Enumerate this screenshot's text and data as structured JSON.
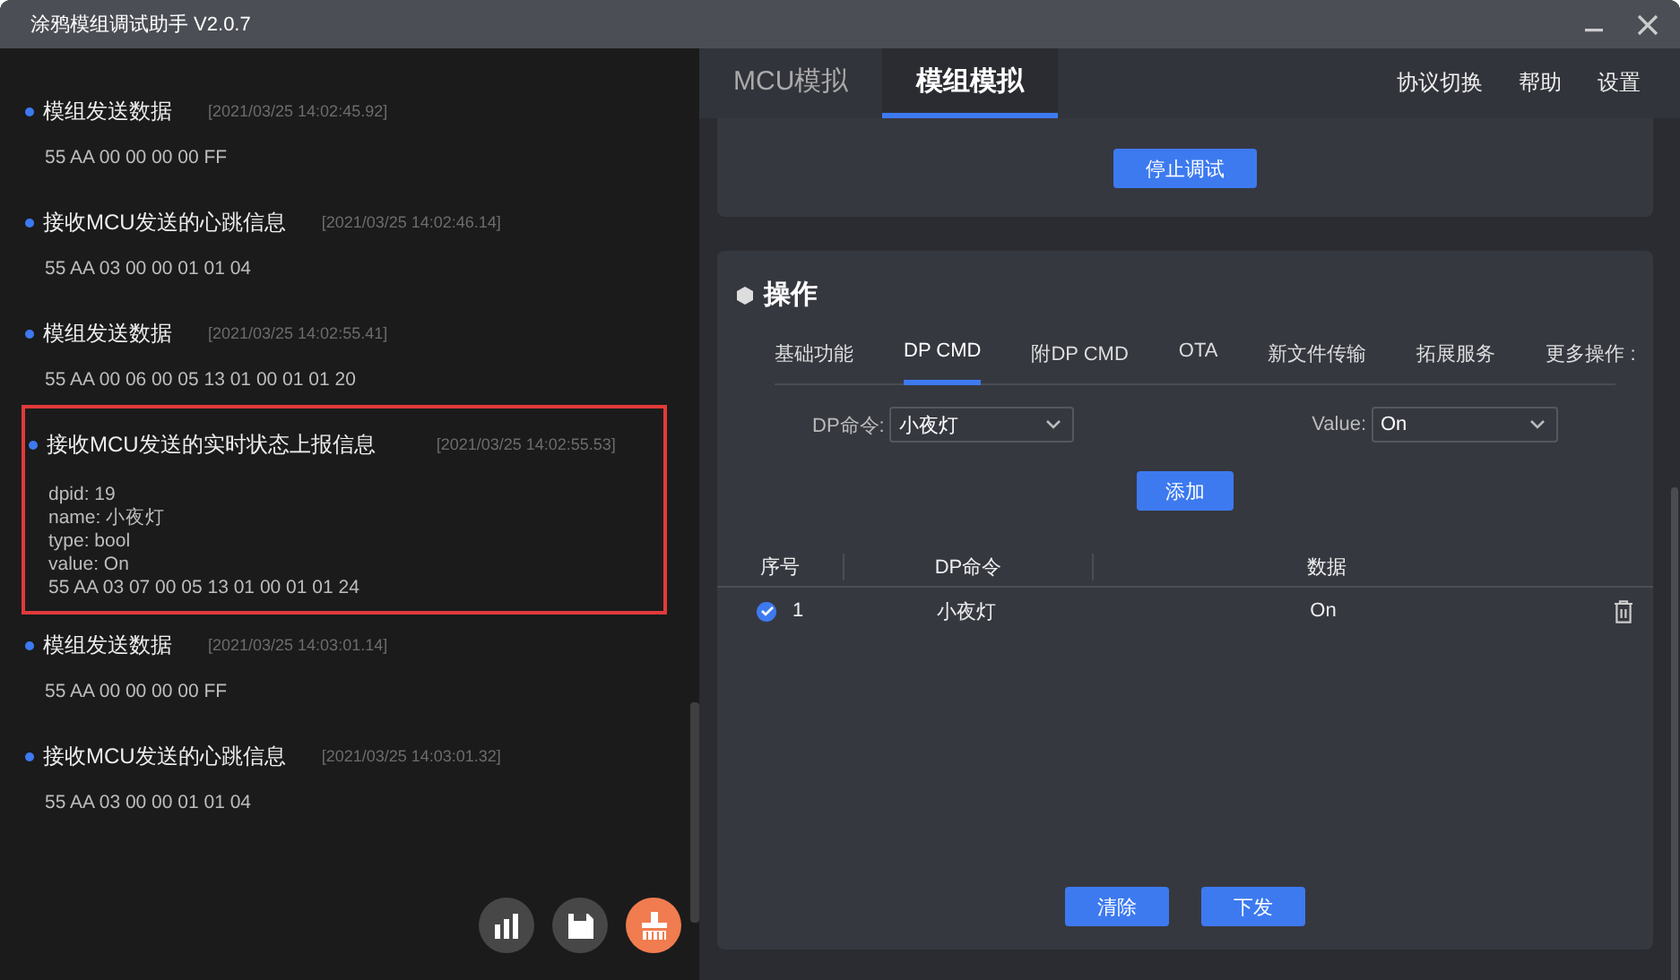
{
  "window": {
    "title": "涂鸦模组调试助手 V2.0.7"
  },
  "log": [
    {
      "title": "模组发送数据",
      "time": "[2021/03/25 14:02:45.92]",
      "lines": [
        "55 AA 00 00 00 00 FF"
      ],
      "highlighted": false
    },
    {
      "title": "接收MCU发送的心跳信息",
      "time": "[2021/03/25 14:02:46.14]",
      "lines": [
        "55 AA 03 00 00 01 01 04"
      ],
      "highlighted": false
    },
    {
      "title": "模组发送数据",
      "time": "[2021/03/25 14:02:55.41]",
      "lines": [
        "55 AA 00 06 00 05 13 01 00 01 01 20"
      ],
      "highlighted": false
    },
    {
      "title": "接收MCU发送的实时状态上报信息",
      "time": "[2021/03/25 14:02:55.53]",
      "lines": [
        "dpid: 19",
        "name: 小夜灯",
        "type: bool",
        "value: On",
        "55 AA 03 07 00 05 13 01 00 01 01 24"
      ],
      "highlighted": true
    },
    {
      "title": "模组发送数据",
      "time": "[2021/03/25 14:03:01.14]",
      "lines": [
        "55 AA 00 00 00 00 FF"
      ],
      "highlighted": false
    },
    {
      "title": "接收MCU发送的心跳信息",
      "time": "[2021/03/25 14:03:01.32]",
      "lines": [
        "55 AA 03 00 00 01 01 04"
      ],
      "highlighted": false
    }
  ],
  "nav": {
    "tabs": [
      {
        "label": "MCU模拟",
        "selected": false
      },
      {
        "label": "模组模拟",
        "selected": true
      }
    ],
    "links": [
      "协议切换",
      "帮助",
      "设置"
    ]
  },
  "debug_button": "停止调试",
  "operations": {
    "title": "操作",
    "tabs": [
      {
        "label": "基础功能",
        "selected": false
      },
      {
        "label": "DP CMD",
        "selected": true
      },
      {
        "label": "附DP CMD",
        "selected": false
      },
      {
        "label": "OTA",
        "selected": false
      },
      {
        "label": "新文件传输",
        "selected": false
      },
      {
        "label": "拓展服务",
        "selected": false
      },
      {
        "label": "更多操作 :",
        "selected": false
      }
    ],
    "dp_field": {
      "label": "DP命令:",
      "value": "小夜灯"
    },
    "value_field": {
      "label": "Value:",
      "value": "On"
    },
    "add_button": "添加",
    "table": {
      "columns": [
        "序号",
        "DP命令",
        "数据"
      ],
      "rows": [
        {
          "checked": true,
          "cells": [
            "1",
            "小夜灯",
            "On"
          ]
        }
      ]
    },
    "buttons": [
      "清除",
      "下发"
    ]
  }
}
